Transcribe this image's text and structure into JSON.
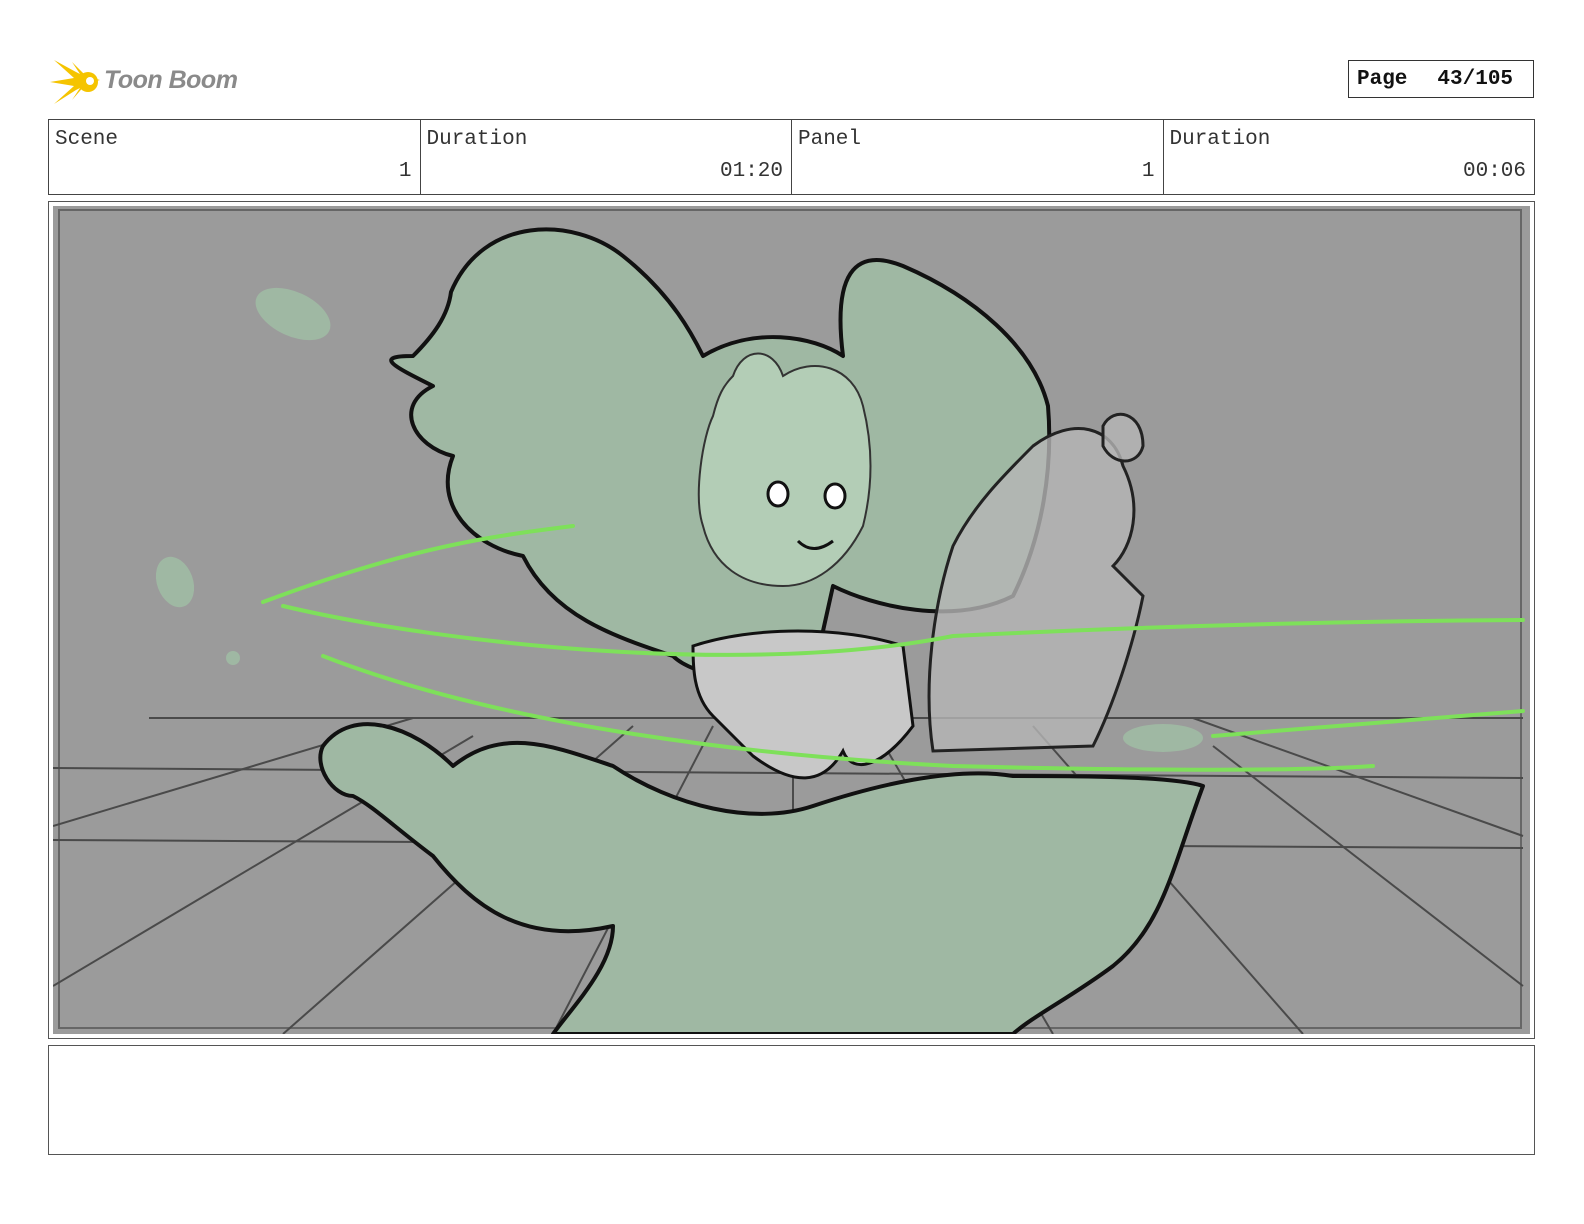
{
  "header": {
    "logo_text": "Toon Boom",
    "page_label": "Page",
    "page_value": "43/105"
  },
  "info": {
    "scene_label": "Scene",
    "scene_value": "1",
    "scene_duration_label": "Duration",
    "scene_duration_value": "01:20",
    "panel_label": "Panel",
    "panel_value": "1",
    "panel_duration_label": "Duration",
    "panel_duration_value": "00:06"
  },
  "notes": {
    "text": ""
  },
  "colors": {
    "panel_background": "#9b9b9b",
    "sketch_fill": "#9fb8a3",
    "speed_line": "#7ee05a",
    "logo_accent": "#f5c400"
  },
  "icons": [
    "toon-boom-logo-icon"
  ]
}
